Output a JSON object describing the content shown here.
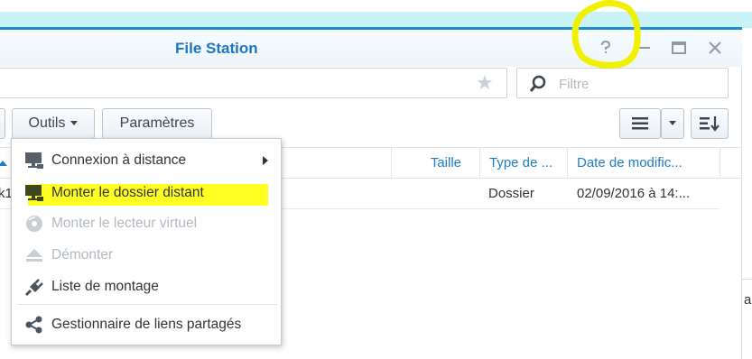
{
  "window": {
    "title": "File Station"
  },
  "search": {
    "placeholder": "Filtre"
  },
  "toolbar": {
    "tools_label": "Outils",
    "settings_label": "Paramètres"
  },
  "columns": {
    "size": "Taille",
    "type": "Type de ...",
    "modified": "Date de modific..."
  },
  "row": {
    "name_partial": "k1",
    "type": "Dossier",
    "modified": "02/09/2016 à 14:..."
  },
  "tools_menu": {
    "items": [
      {
        "label": "Connexion à distance",
        "icon": "monitor-icon",
        "state": "enabled",
        "has_submenu": true
      },
      {
        "label": "Monter le dossier distant",
        "icon": "monitor-icon",
        "state": "enabled",
        "highlighted": true
      },
      {
        "label": "Monter le lecteur virtuel",
        "icon": "disc-icon",
        "state": "disabled"
      },
      {
        "label": "Démonter",
        "icon": "eject-icon",
        "state": "disabled"
      },
      {
        "label": "Liste de montage",
        "icon": "plug-icon",
        "state": "enabled"
      },
      {
        "label": "Gestionnaire de liens partagés",
        "icon": "share-icon",
        "state": "enabled"
      }
    ]
  },
  "edge_text": "a",
  "colors": {
    "accent": "#1e7cc4",
    "title_bar_border": "#1e8ad8",
    "highlight": "#ffff22",
    "annotation": "#f0f000",
    "disabled_text": "#b2b9c0"
  }
}
